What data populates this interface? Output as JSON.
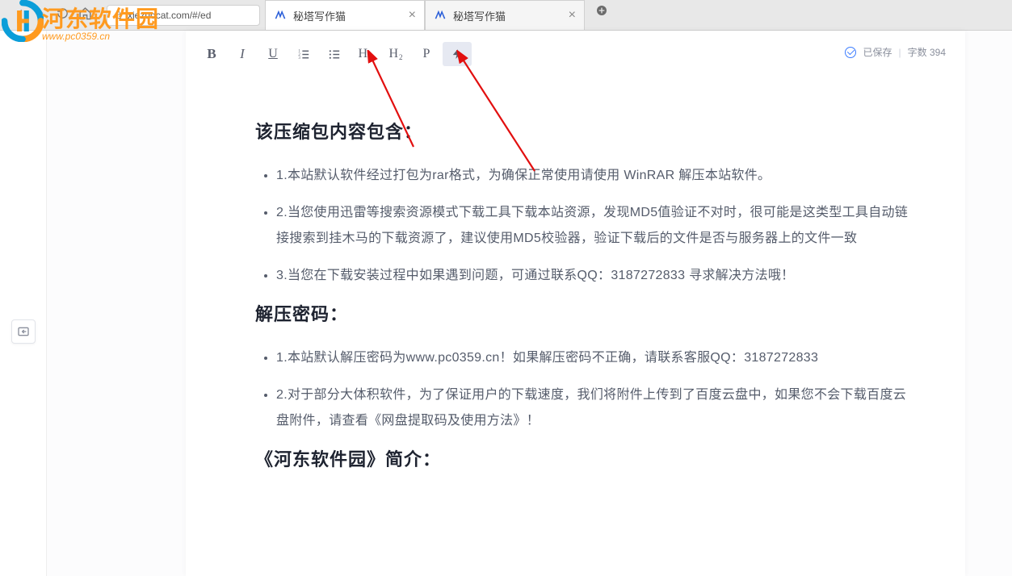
{
  "browser": {
    "url": "xiezuocat.com/#/ed",
    "tabs": [
      {
        "title": "秘塔写作猫",
        "active": true
      },
      {
        "title": "秘塔写作猫",
        "active": false
      }
    ]
  },
  "watermark": {
    "title": "河东软件园",
    "url": "www.pc0359.cn"
  },
  "toolbar": {
    "bold": "B",
    "italic": "I",
    "underline": "U",
    "h1_prefix": "H",
    "h1_sub": "1",
    "h2_prefix": "H",
    "h2_sub": "2",
    "para": "P"
  },
  "status": {
    "saved": "已保存",
    "wc_label": "字数",
    "wc_value": "394"
  },
  "doc": {
    "h_contents": "该压缩包内容包含：",
    "contents": [
      "1.本站默认软件经过打包为rar格式，为确保正常使用请使用 WinRAR 解压本站软件。",
      "2.当您使用迅雷等搜索资源模式下载工具下载本站资源，发现MD5值验证不对时，很可能是这类型工具自动链接搜索到挂木马的下载资源了，建议使用MD5校验器，验证下载后的文件是否与服务器上的文件一致",
      "3.当您在下载安装过程中如果遇到问题，可通过联系QQ：3187272833 寻求解决方法哦！"
    ],
    "h_password": "解压密码：",
    "password": [
      "1.本站默认解压密码为www.pc0359.cn！如果解压密码不正确，请联系客服QQ：3187272833",
      "2.对于部分大体积软件，为了保证用户的下载速度，我们将附件上传到了百度云盘中，如果您不会下载百度云盘附件，请查看《网盘提取码及使用方法》！"
    ],
    "h_intro": "《河东软件园》简介："
  }
}
